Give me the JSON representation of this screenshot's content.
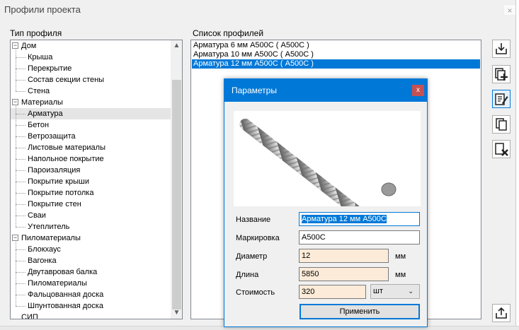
{
  "window": {
    "title": "Профили проекта",
    "close": "×"
  },
  "tree": {
    "label": "Тип профиля",
    "groups": [
      {
        "name": "Дом",
        "items": [
          "Крыша",
          "Перекрытие",
          "Состав секции стены",
          "Стена"
        ]
      },
      {
        "name": "Материалы",
        "items": [
          "Арматура",
          "Бетон",
          "Ветрозащита",
          "Листовые материалы",
          "Напольное покрытие",
          "Пароизаляция",
          "Покрытие крыши",
          "Покрытие потолка",
          "Покрытие стен",
          "Сваи",
          "Утеплитель"
        ]
      },
      {
        "name": "Пиломатериалы",
        "items": [
          "Блокхаус",
          "Вагонка",
          "Двутавровая балка",
          "Пиломатериалы",
          "Фальцованная доска",
          "Шпунтованная доска"
        ]
      },
      {
        "name": "СИП",
        "items": []
      }
    ],
    "selected": "Арматура",
    "expander_minus": "−",
    "scroll_up": "▲",
    "scroll_down": "▼"
  },
  "profiles": {
    "label": "Список профилей",
    "items": [
      "Арматура 6 мм А500С ( А500С )",
      "Арматура 10 мм А500С ( А500С )",
      "Арматура 12 мм А500С ( А500С )"
    ],
    "selected_index": 2
  },
  "toolbar": {
    "buttons": [
      "import-icon",
      "add-profile-icon",
      "edit-profile-icon",
      "copy-profile-icon",
      "delete-profile-icon",
      "export-icon"
    ]
  },
  "dialog": {
    "title": "Параметры",
    "close": "x",
    "fields": {
      "name_label": "Название",
      "name_value": "Арматура 12 мм А500С",
      "marking_label": "Маркировка",
      "marking_value": "А500С",
      "diameter_label": "Диаметр",
      "diameter_value": "12",
      "diameter_unit": "мм",
      "length_label": "Длина",
      "length_value": "5850",
      "length_unit": "мм",
      "cost_label": "Стоимость",
      "cost_value": "320",
      "cost_unit": "шт"
    },
    "apply": "Применить"
  },
  "colors": {
    "accent": "#0078d7",
    "numeric_field": "#fcebd8",
    "close_red": "#c75050"
  }
}
